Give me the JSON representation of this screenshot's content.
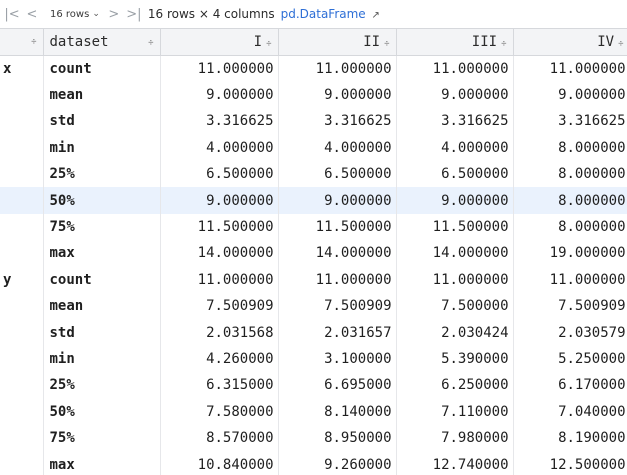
{
  "toolbar": {
    "first_icon": "|<",
    "prev_icon": "<",
    "rows_label": "16 rows",
    "next_icon": ">",
    "last_icon": ">|",
    "summary": "16 rows × 4 columns",
    "df_link": "pd.DataFrame",
    "df_link_arrow": "↗"
  },
  "header": {
    "index_sort": "⇕",
    "columns": [
      "dataset",
      "I",
      "II",
      "III",
      "IV"
    ],
    "sort_glyph": "÷"
  },
  "rows": [
    {
      "g": "x",
      "stat": "count",
      "v": [
        "11.000000",
        "11.000000",
        "11.000000",
        "11.000000"
      ]
    },
    {
      "g": "",
      "stat": "mean",
      "v": [
        "9.000000",
        "9.000000",
        "9.000000",
        "9.000000"
      ]
    },
    {
      "g": "",
      "stat": "std",
      "v": [
        "3.316625",
        "3.316625",
        "3.316625",
        "3.316625"
      ]
    },
    {
      "g": "",
      "stat": "min",
      "v": [
        "4.000000",
        "4.000000",
        "4.000000",
        "8.000000"
      ]
    },
    {
      "g": "",
      "stat": "25%",
      "v": [
        "6.500000",
        "6.500000",
        "6.500000",
        "8.000000"
      ]
    },
    {
      "g": "",
      "stat": "50%",
      "v": [
        "9.000000",
        "9.000000",
        "9.000000",
        "8.000000"
      ],
      "selected": true
    },
    {
      "g": "",
      "stat": "75%",
      "v": [
        "11.500000",
        "11.500000",
        "11.500000",
        "8.000000"
      ]
    },
    {
      "g": "",
      "stat": "max",
      "v": [
        "14.000000",
        "14.000000",
        "14.000000",
        "19.000000"
      ]
    },
    {
      "g": "y",
      "stat": "count",
      "v": [
        "11.000000",
        "11.000000",
        "11.000000",
        "11.000000"
      ]
    },
    {
      "g": "",
      "stat": "mean",
      "v": [
        "7.500909",
        "7.500909",
        "7.500000",
        "7.500909"
      ]
    },
    {
      "g": "",
      "stat": "std",
      "v": [
        "2.031568",
        "2.031657",
        "2.030424",
        "2.030579"
      ]
    },
    {
      "g": "",
      "stat": "min",
      "v": [
        "4.260000",
        "3.100000",
        "5.390000",
        "5.250000"
      ]
    },
    {
      "g": "",
      "stat": "25%",
      "v": [
        "6.315000",
        "6.695000",
        "6.250000",
        "6.170000"
      ]
    },
    {
      "g": "",
      "stat": "50%",
      "v": [
        "7.580000",
        "8.140000",
        "7.110000",
        "7.040000"
      ]
    },
    {
      "g": "",
      "stat": "75%",
      "v": [
        "8.570000",
        "8.950000",
        "7.980000",
        "8.190000"
      ]
    },
    {
      "g": "",
      "stat": "max",
      "v": [
        "10.840000",
        "9.260000",
        "12.740000",
        "12.500000"
      ]
    }
  ]
}
